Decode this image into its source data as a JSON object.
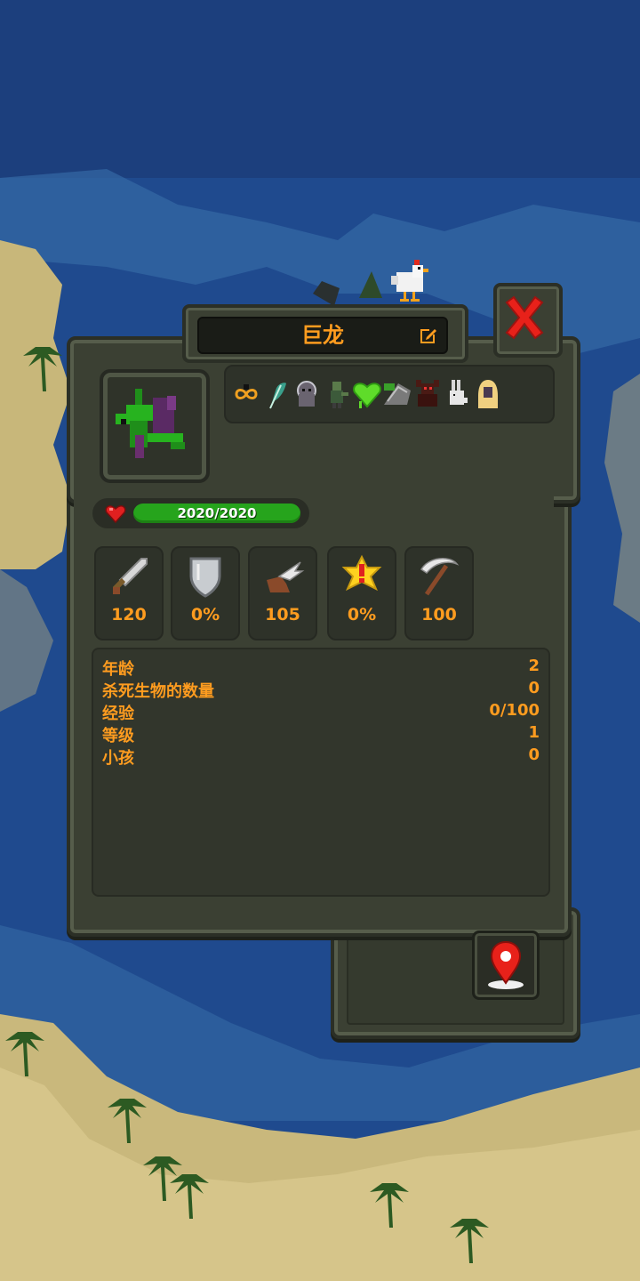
{
  "unit": {
    "name": "巨龙",
    "health_text": "2020/2020",
    "health_fraction": 1.0
  },
  "trait_icons": [
    "infinity-icon",
    "feather-icon",
    "ghost-icon",
    "zombie-icon",
    "acid-heart-icon",
    "wing-icon",
    "demon-icon",
    "rabbit-icon",
    "hooded-figure-icon"
  ],
  "stats": [
    {
      "icon": "sword-icon",
      "value": "120"
    },
    {
      "icon": "shield-icon",
      "value": "0%"
    },
    {
      "icon": "winged-boot-icon",
      "value": "105"
    },
    {
      "icon": "critical-star-icon",
      "value": "0%"
    },
    {
      "icon": "scythe-icon",
      "value": "100"
    }
  ],
  "info": [
    {
      "label": "年龄",
      "value": "2"
    },
    {
      "label": "杀死生物的数量",
      "value": "0"
    },
    {
      "label": "经验",
      "value": "0/100"
    },
    {
      "label": "等级",
      "value": "1"
    },
    {
      "label": "小孩",
      "value": "0"
    }
  ],
  "colors": {
    "accent_text": "#ff9c1f",
    "health_bar": "#26a41c",
    "panel": "#3b4033",
    "close_x": "#e8211a"
  }
}
